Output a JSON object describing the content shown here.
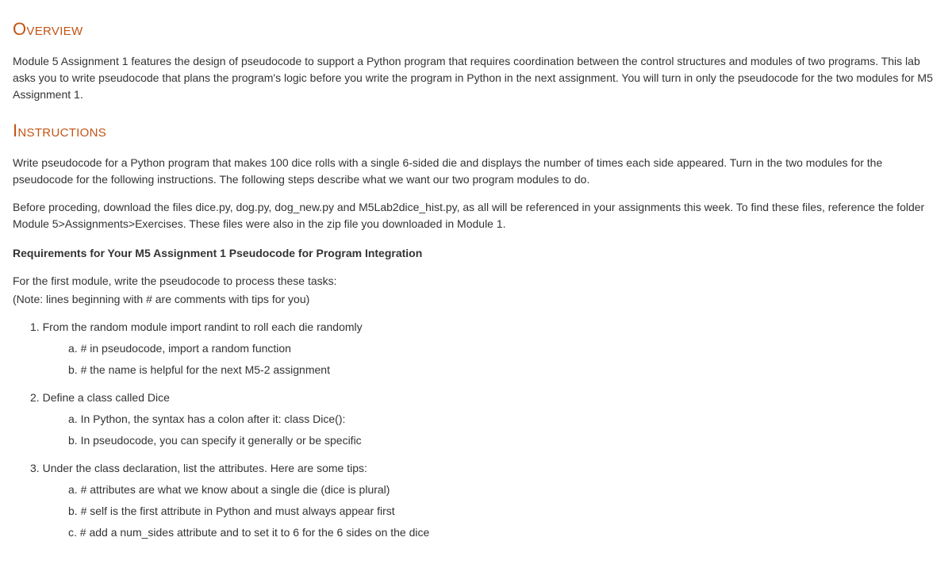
{
  "overview": {
    "heading": "Overview",
    "body": "Module 5 Assignment 1 features the design of pseudocode to support a Python program that requires coordination between the control structures and modules of two programs. This lab asks you to write pseudocode that plans the program's logic before you write the program in Python in the next assignment. You will turn in only the pseudocode for the two modules for M5 Assignment 1."
  },
  "instructions": {
    "heading": "Instructions",
    "para1": "Write pseudocode for a Python program that makes 100 dice rolls with a single 6-sided die and displays the number of times each side appeared. Turn in the two modules for the pseudocode for the following instructions. The following steps describe what we want our two program modules to do.",
    "para2": "Before proceding, download the files dice.py, dog.py, dog_new.py and M5Lab2dice_hist.py, as all will be referenced in your assignments this week. To find these files, reference the folder Module 5>Assignments>Exercises. These files were also in the zip file you downloaded in Module 1.",
    "reqHeading": "Requirements for Your M5 Assignment 1 Pseudocode for Program Integration",
    "firstModuleIntro": "For the first module, write the pseudocode to process these tasks:",
    "note": "(Note: lines beginning with # are comments with tips for you)",
    "steps": [
      {
        "num": "1.",
        "text": "From the random module import randint to roll each die randomly",
        "subs": [
          {
            "letter": "a.",
            "text": "# in pseudocode, import a random function"
          },
          {
            "letter": "b.",
            "text": "# the name is helpful for the next M5-2 assignment"
          }
        ]
      },
      {
        "num": "2.",
        "text": "Define a class called Dice",
        "subs": [
          {
            "letter": "a.",
            "text": "In Python, the syntax has a colon after it: class Dice():"
          },
          {
            "letter": "b.",
            "text": "In pseudocode, you can specify it generally or be specific"
          }
        ]
      },
      {
        "num": "3.",
        "text": "Under the class declaration, list the attributes. Here are some tips:",
        "subs": [
          {
            "letter": "a.",
            "text": "# attributes are what we know about a single die (dice is plural)"
          },
          {
            "letter": "b.",
            "text": "# self is the first attribute in Python and must always appear first"
          },
          {
            "letter": "c.",
            "text": "# add a num_sides attribute and to set it to 6 for the 6 sides on the dice"
          }
        ]
      }
    ]
  }
}
